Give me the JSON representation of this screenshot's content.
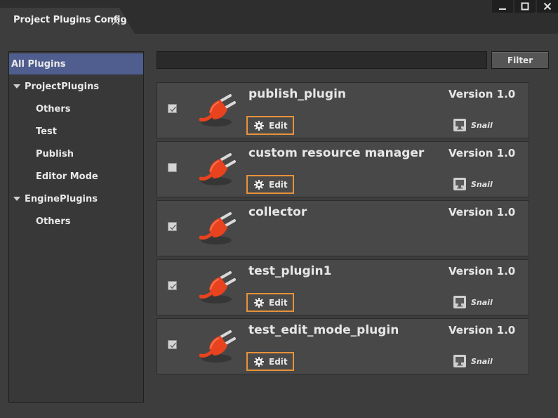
{
  "window": {
    "tab_title": "Project Plugins Config"
  },
  "sidebar": {
    "items": [
      {
        "label": "All Plugins",
        "level": 0,
        "expandable": false,
        "selected": true
      },
      {
        "label": "ProjectPlugins",
        "level": 0,
        "expandable": true,
        "selected": false
      },
      {
        "label": "Others",
        "level": 1,
        "expandable": false,
        "selected": false
      },
      {
        "label": "Test",
        "level": 1,
        "expandable": false,
        "selected": false
      },
      {
        "label": "Publish",
        "level": 1,
        "expandable": false,
        "selected": false
      },
      {
        "label": "Editor Mode",
        "level": 1,
        "expandable": false,
        "selected": false
      },
      {
        "label": "EnginePlugins",
        "level": 0,
        "expandable": true,
        "selected": false
      },
      {
        "label": "Others",
        "level": 1,
        "expandable": false,
        "selected": false
      }
    ]
  },
  "filter": {
    "value": "",
    "button_label": "Filter"
  },
  "plugins": [
    {
      "name": "publish_plugin",
      "version": "Version 1.0",
      "checked": true,
      "has_edit": true,
      "edit_label": "Edit",
      "author": "Snail",
      "author_icon": "monitor-icon"
    },
    {
      "name": "custom resource manager",
      "version": "Version 1.0",
      "checked": false,
      "has_edit": true,
      "edit_label": "Edit",
      "author": "Snail",
      "author_icon": "monitor-icon"
    },
    {
      "name": "collector",
      "version": "Version 1.0",
      "checked": true,
      "has_edit": false,
      "edit_label": "",
      "author": "",
      "author_icon": ""
    },
    {
      "name": "test_plugin1",
      "version": "Version 1.0",
      "checked": true,
      "has_edit": true,
      "edit_label": "Edit",
      "author": "Snail",
      "author_icon": "monitor-icon"
    },
    {
      "name": "test_edit_mode_plugin",
      "version": "Version 1.0",
      "checked": true,
      "has_edit": true,
      "edit_label": "Edit",
      "author": "Snail",
      "author_icon": "monitor-icon"
    }
  ],
  "colors": {
    "accent_edit_border": "#e8923a",
    "selection": "#4f5e8f",
    "plug_icon": "#e8421e"
  }
}
